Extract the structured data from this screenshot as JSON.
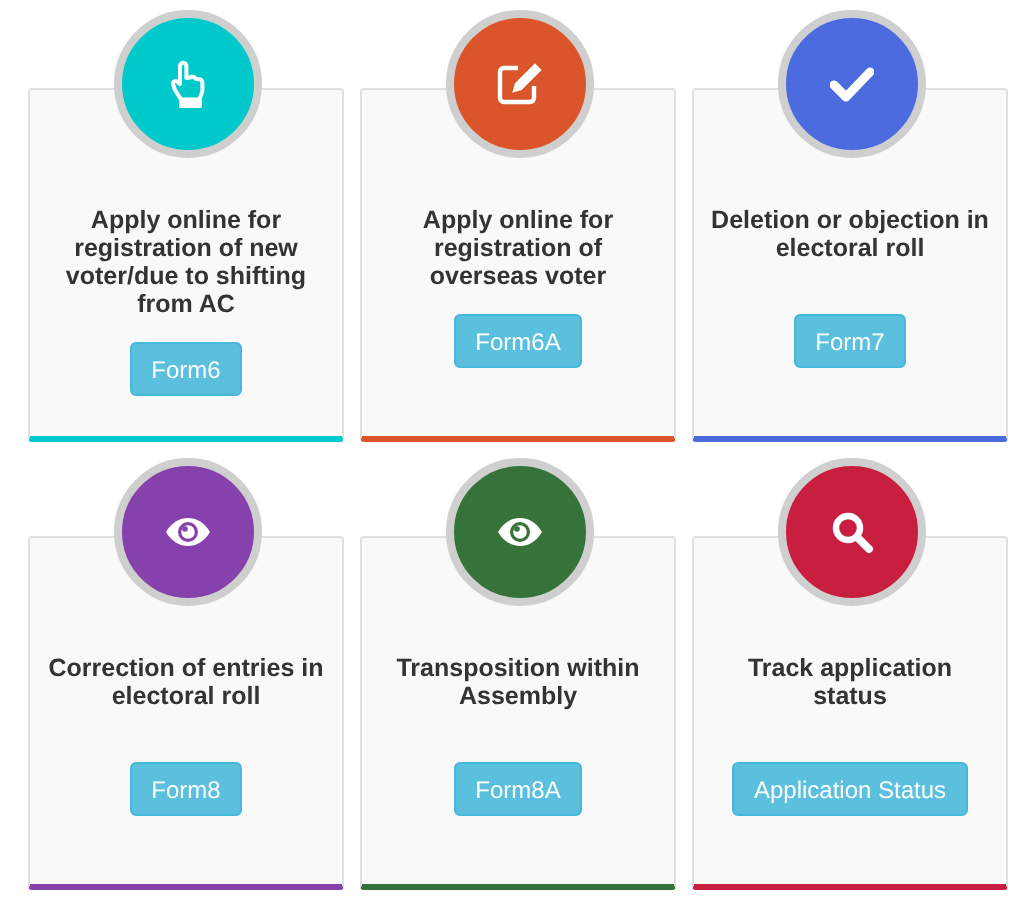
{
  "cards": [
    {
      "kind": "hand",
      "color": "#00c9cc",
      "title": "Apply online for registration of new voter/due to shifting from AC",
      "button": "Form6"
    },
    {
      "kind": "edit",
      "color": "#db552b",
      "title": "Apply online for registration of overseas voter",
      "button": "Form6A"
    },
    {
      "kind": "check",
      "color": "#4b6bdf",
      "title": "Deletion or objection in electoral roll",
      "button": "Form7"
    },
    {
      "kind": "eye",
      "color": "#8741ac",
      "title": "Correction of entries in electoral roll",
      "button": "Form8"
    },
    {
      "kind": "eye",
      "color": "#36733b",
      "title": "Transposition within Assembly",
      "button": "Form8A"
    },
    {
      "kind": "search",
      "color": "#c81f41",
      "title": "Track application status",
      "button": "Application Status"
    }
  ]
}
